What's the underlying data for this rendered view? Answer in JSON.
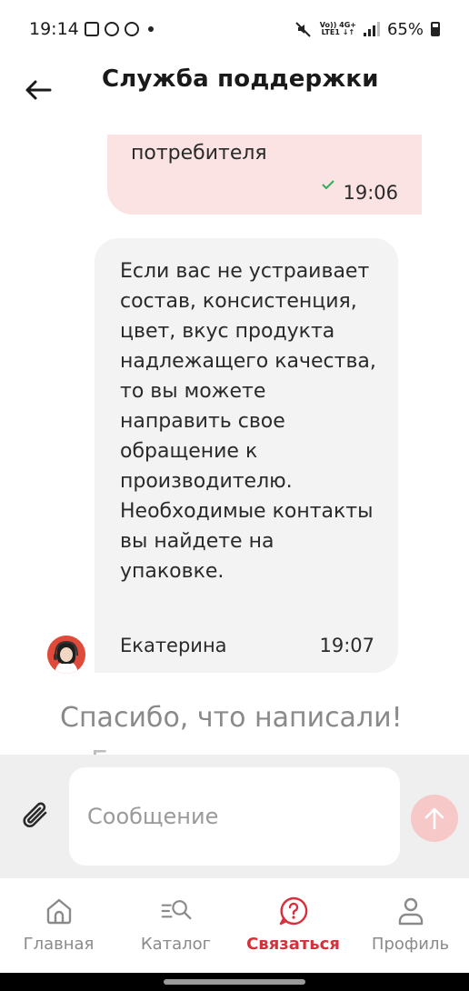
{
  "status_bar": {
    "time": "19:14",
    "network_top": "Vo)) 4G+",
    "network_bottom": "LTE1 ↓↑",
    "battery": "65%"
  },
  "header": {
    "back_icon": "arrow-left-icon",
    "title": "Служба поддержки"
  },
  "chat": {
    "outgoing": {
      "text": "потребителя",
      "time": "19:06",
      "status_icon": "check-icon"
    },
    "incoming": {
      "text": "Если вас не устраивает состав, консистенция, цвет, вкус продукта надлежащего качества, то вы можете направить свое обращение к производителю. Необходимые контакты вы найдете на упаковке.",
      "author": "Екатерина",
      "time": "19:07"
    },
    "system_message": "Спасибо, что написали!",
    "system_message_next": "Г"
  },
  "composer": {
    "placeholder": "Сообщение",
    "attach_icon": "paperclip-icon",
    "send_icon": "arrow-up-icon"
  },
  "bottom_nav": {
    "items": [
      {
        "label": "Главная",
        "icon": "home-icon"
      },
      {
        "label": "Каталог",
        "icon": "catalog-search-icon"
      },
      {
        "label": "Связаться",
        "icon": "help-chat-icon"
      },
      {
        "label": "Профиль",
        "icon": "profile-icon"
      }
    ],
    "active": "Связаться"
  },
  "colors": {
    "accent": "#d8303b",
    "outgoing_bubble": "#fbe3e3",
    "incoming_bubble": "#f3f3f3",
    "send_button": "#f6c8c8"
  }
}
